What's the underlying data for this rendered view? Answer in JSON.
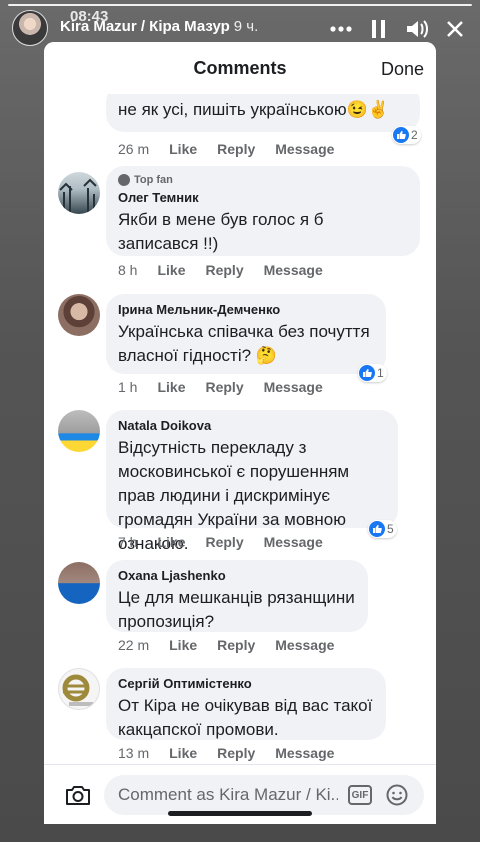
{
  "story": {
    "time": "08:43",
    "name": "Kira Mazur / Кіра Мазур",
    "ago": "9 ч."
  },
  "sheet": {
    "title": "Comments",
    "done": "Done"
  },
  "labels": {
    "like": "Like",
    "reply": "Reply",
    "message": "Message"
  },
  "comments": [
    {
      "text": "не як усі, пишіть українською😉✌️",
      "time": "26 m",
      "reactions": "2"
    },
    {
      "badge": "Top fan",
      "name": "Олег Темник",
      "text": "Якби в мене був голос я б записався !!)",
      "time": "8 h"
    },
    {
      "name": "Ірина Мельник-Демченко",
      "text": "Українська співачка без почуття власної гідності? 🤔",
      "time": "1 h",
      "reactions": "1"
    },
    {
      "name": "Natala Doikova",
      "text": "Відсутність перекладу з московинської є порушенням прав людини і дискримінує громадян України за мовною ознакою.",
      "time": "7 h",
      "reactions": "5"
    },
    {
      "name": "Oxana Ljashenko",
      "text": "Це для мешканців рязанщини пропозиція?",
      "time": "22 m"
    },
    {
      "name": "Сергій Оптимістенко",
      "text": "От Кіра не очікував від вас такої какцапскої промови.",
      "time": "13 m"
    }
  ],
  "composer": {
    "placeholder": "Comment as Kira Mazur / Ki...",
    "gif_label": "GIF"
  }
}
